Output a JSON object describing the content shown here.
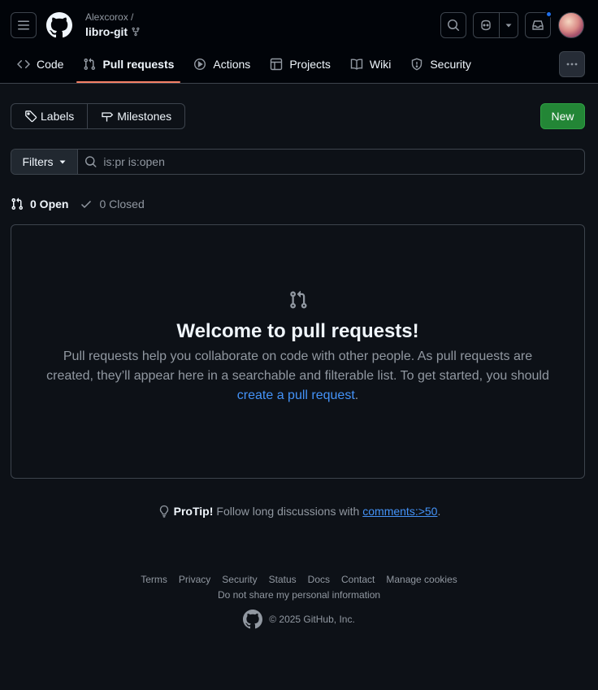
{
  "header": {
    "owner": "Alexcorox /",
    "repo": "libro-git"
  },
  "tabs": [
    {
      "label": "Code",
      "icon": "code-icon"
    },
    {
      "label": "Pull requests",
      "icon": "pull-request-icon"
    },
    {
      "label": "Actions",
      "icon": "play-icon"
    },
    {
      "label": "Projects",
      "icon": "table-icon"
    },
    {
      "label": "Wiki",
      "icon": "book-icon"
    },
    {
      "label": "Security",
      "icon": "shield-icon"
    }
  ],
  "toolbar": {
    "labels": "Labels",
    "milestones": "Milestones",
    "new": "New"
  },
  "filter": {
    "filters_label": "Filters",
    "query": "is:pr is:open"
  },
  "states": {
    "open": "0 Open",
    "closed": "0 Closed"
  },
  "blankslate": {
    "title": "Welcome to pull requests!",
    "text_before": "Pull requests help you collaborate on code with other people. As pull requests are created, they’ll appear here in a searchable and filterable list. To get started, you should ",
    "link": "create a pull request",
    "text_after": "."
  },
  "protip": {
    "label": "ProTip!",
    "text": "Follow long discussions with",
    "link": "comments:>50",
    "end": "."
  },
  "footer": {
    "links": [
      "Terms",
      "Privacy",
      "Security",
      "Status",
      "Docs",
      "Contact",
      "Manage cookies"
    ],
    "personal": "Do not share my personal information",
    "copyright": "© 2025 GitHub, Inc."
  },
  "colors": {
    "accent": "#f78166",
    "link": "#4493f8",
    "new_button": "#238636",
    "background": "#0d1117"
  }
}
